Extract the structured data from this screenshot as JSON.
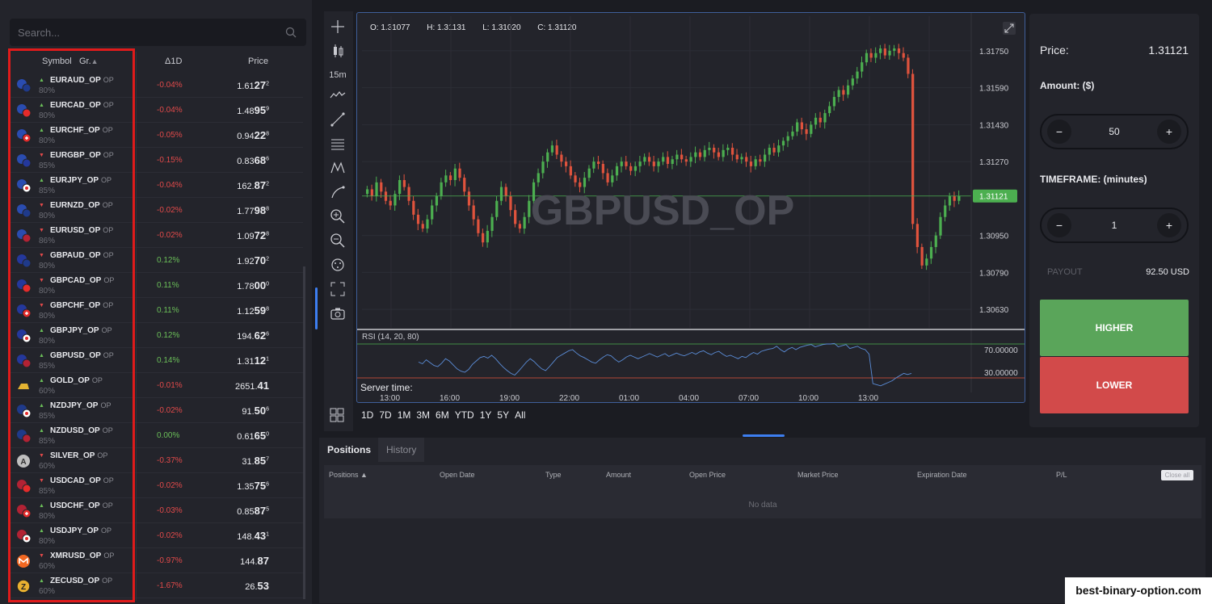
{
  "search": {
    "placeholder": "Search..."
  },
  "table_header": {
    "symbol": "Symbol",
    "group": "Gr.",
    "change": "Δ1D",
    "price": "Price"
  },
  "assets": [
    {
      "symbol": "EURAUD_OP",
      "op": "OP",
      "payout": "80%",
      "dir": "up",
      "change": "-0.04%",
      "price_main": "1.61",
      "price_big": "27",
      "price_sup": "2",
      "flag": "eu-au"
    },
    {
      "symbol": "EURCAD_OP",
      "op": "OP",
      "payout": "80%",
      "dir": "up",
      "change": "-0.04%",
      "price_main": "1.48",
      "price_big": "95",
      "price_sup": "9",
      "flag": "eu-ca"
    },
    {
      "symbol": "EURCHF_OP",
      "op": "OP",
      "payout": "80%",
      "dir": "up",
      "change": "-0.05%",
      "price_main": "0.94",
      "price_big": "22",
      "price_sup": "8",
      "flag": "eu-ch"
    },
    {
      "symbol": "EURGBP_OP",
      "op": "OP",
      "payout": "85%",
      "dir": "down",
      "change": "-0.15%",
      "price_main": "0.83",
      "price_big": "68",
      "price_sup": "6",
      "flag": "eu-gb"
    },
    {
      "symbol": "EURJPY_OP",
      "op": "OP",
      "payout": "85%",
      "dir": "up",
      "change": "-0.04%",
      "price_main": "162.",
      "price_big": "87",
      "price_sup": "2",
      "flag": "eu-jp"
    },
    {
      "symbol": "EURNZD_OP",
      "op": "OP",
      "payout": "80%",
      "dir": "down",
      "change": "-0.02%",
      "price_main": "1.77",
      "price_big": "98",
      "price_sup": "8",
      "flag": "eu-nz"
    },
    {
      "symbol": "EURUSD_OP",
      "op": "OP",
      "payout": "86%",
      "dir": "down",
      "change": "-0.02%",
      "price_main": "1.09",
      "price_big": "72",
      "price_sup": "8",
      "flag": "eu-us"
    },
    {
      "symbol": "GBPAUD_OP",
      "op": "OP",
      "payout": "80%",
      "dir": "down",
      "change": "0.12%",
      "price_main": "1.92",
      "price_big": "70",
      "price_sup": "2",
      "flag": "gb-au"
    },
    {
      "symbol": "GBPCAD_OP",
      "op": "OP",
      "payout": "80%",
      "dir": "down",
      "change": "0.11%",
      "price_main": "1.78",
      "price_big": "00",
      "price_sup": "0",
      "flag": "gb-ca"
    },
    {
      "symbol": "GBPCHF_OP",
      "op": "OP",
      "payout": "80%",
      "dir": "down",
      "change": "0.11%",
      "price_main": "1.12",
      "price_big": "59",
      "price_sup": "8",
      "flag": "gb-ch"
    },
    {
      "symbol": "GBPJPY_OP",
      "op": "OP",
      "payout": "80%",
      "dir": "up",
      "change": "0.12%",
      "price_main": "194.",
      "price_big": "62",
      "price_sup": "6",
      "flag": "gb-jp"
    },
    {
      "symbol": "GBPUSD_OP",
      "op": "OP",
      "payout": "85%",
      "dir": "up",
      "change": "0.14%",
      "price_main": "1.31",
      "price_big": "12",
      "price_sup": "1",
      "flag": "gb-us"
    },
    {
      "symbol": "GOLD_OP",
      "op": "OP",
      "payout": "60%",
      "dir": "up",
      "change": "-0.01%",
      "price_main": "2651.",
      "price_big": "41",
      "price_sup": "",
      "flag": "gold"
    },
    {
      "symbol": "NZDJPY_OP",
      "op": "OP",
      "payout": "85%",
      "dir": "up",
      "change": "-0.02%",
      "price_main": "91.",
      "price_big": "50",
      "price_sup": "6",
      "flag": "nz-jp"
    },
    {
      "symbol": "NZDUSD_OP",
      "op": "OP",
      "payout": "85%",
      "dir": "up",
      "change": "0.00%",
      "price_main": "0.61",
      "price_big": "65",
      "price_sup": "0",
      "flag": "nz-us"
    },
    {
      "symbol": "SILVER_OP",
      "op": "OP",
      "payout": "60%",
      "dir": "down",
      "change": "-0.37%",
      "price_main": "31.",
      "price_big": "85",
      "price_sup": "7",
      "flag": "silver"
    },
    {
      "symbol": "USDCAD_OP",
      "op": "OP",
      "payout": "85%",
      "dir": "down",
      "change": "-0.02%",
      "price_main": "1.35",
      "price_big": "75",
      "price_sup": "6",
      "flag": "us-ca"
    },
    {
      "symbol": "USDCHF_OP",
      "op": "OP",
      "payout": "80%",
      "dir": "up",
      "change": "-0.03%",
      "price_main": "0.85",
      "price_big": "87",
      "price_sup": "5",
      "flag": "us-ch"
    },
    {
      "symbol": "USDJPY_OP",
      "op": "OP",
      "payout": "80%",
      "dir": "up",
      "change": "-0.02%",
      "price_main": "148.",
      "price_big": "43",
      "price_sup": "1",
      "flag": "us-jp"
    },
    {
      "symbol": "XMRUSD_OP",
      "op": "OP",
      "payout": "60%",
      "dir": "down",
      "change": "-0.97%",
      "price_main": "144.",
      "price_big": "87",
      "price_sup": "",
      "flag": "xmr"
    },
    {
      "symbol": "ZECUSD_OP",
      "op": "OP",
      "payout": "60%",
      "dir": "up",
      "change": "-1.67%",
      "price_main": "26.",
      "price_big": "53",
      "price_sup": "",
      "flag": "zec"
    }
  ],
  "toolbar": {
    "interval": "15m"
  },
  "chart": {
    "ohlc": {
      "o": "O: 1.31077",
      "h": "H: 1.31131",
      "l": "L: 1.31020",
      "c": "C: 1.31120"
    },
    "symbol_watermark": "GBPUSD_OP",
    "current_price_label": "1.31121",
    "price_ticks": [
      "1.31750",
      "1.31590",
      "1.31430",
      "1.31270",
      "1.30950",
      "1.30790",
      "1.30630"
    ],
    "rsi_label": "RSI (14, 20, 80)",
    "rsi_levels": [
      "70.00000",
      "30.00000"
    ],
    "server_time_label": "Server time:",
    "time_ticks": [
      "13:00",
      "16:00",
      "19:00",
      "22:00",
      "01:00",
      "04:00",
      "07:00",
      "10:00",
      "13:00"
    ],
    "ranges": [
      "1D",
      "7D",
      "1M",
      "3M",
      "6M",
      "YTD",
      "1Y",
      "5Y",
      "All"
    ],
    "colors": {
      "up": "#4caf50",
      "down": "#e0533d",
      "accent": "#3d7ef0"
    }
  },
  "chart_data": {
    "type": "candlestick",
    "ylim": [
      1.3055,
      1.3183
    ],
    "current_price": 1.31121,
    "candle_closes": [
      1.3115,
      1.3112,
      1.3118,
      1.3114,
      1.311,
      1.3108,
      1.3113,
      1.3119,
      1.3116,
      1.311,
      1.3104,
      1.31,
      1.3098,
      1.3102,
      1.3108,
      1.3112,
      1.3118,
      1.3121,
      1.3119,
      1.3124,
      1.312,
      1.3114,
      1.3108,
      1.3102,
      1.3096,
      1.3092,
      1.3097,
      1.3103,
      1.311,
      1.3116,
      1.3112,
      1.3106,
      1.31,
      1.3098,
      1.3103,
      1.311,
      1.3118,
      1.3122,
      1.3127,
      1.3131,
      1.3134,
      1.313,
      1.3127,
      1.3125,
      1.3121,
      1.3118,
      1.3116,
      1.312,
      1.3124,
      1.3127,
      1.3126,
      1.3122,
      1.3118,
      1.3121,
      1.3125,
      1.3127,
      1.3125,
      1.3123,
      1.3125,
      1.3127,
      1.3129,
      1.3127,
      1.3125,
      1.3127,
      1.3129,
      1.3126,
      1.3128,
      1.313,
      1.3128,
      1.3127,
      1.3129,
      1.3131,
      1.3129,
      1.3132,
      1.3133,
      1.3131,
      1.3129,
      1.3132,
      1.3133,
      1.313,
      1.3128,
      1.3129,
      1.3127,
      1.3125,
      1.3128,
      1.3127,
      1.313,
      1.3133,
      1.3131,
      1.3134,
      1.3136,
      1.3138,
      1.314,
      1.3144,
      1.3141,
      1.3139,
      1.3143,
      1.3146,
      1.3144,
      1.3148,
      1.3151,
      1.3155,
      1.3158,
      1.3156,
      1.316,
      1.3163,
      1.3166,
      1.317,
      1.3174,
      1.3172,
      1.3174,
      1.3176,
      1.3173,
      1.3175,
      1.3176,
      1.3174,
      1.3172,
      1.3165,
      1.31,
      1.309,
      1.3082,
      1.3085,
      1.309,
      1.3095,
      1.3103,
      1.3108,
      1.3112,
      1.311,
      1.3112
    ],
    "rsi": [
      48,
      45,
      52,
      47,
      42,
      40,
      46,
      54,
      50,
      43,
      36,
      32,
      30,
      35,
      44,
      50,
      56,
      58,
      55,
      60,
      54,
      46,
      39,
      33,
      28,
      25,
      32,
      40,
      48,
      54,
      49,
      42,
      36,
      33,
      40,
      48,
      56,
      60,
      64,
      68,
      70,
      64,
      59,
      56,
      52,
      48,
      46,
      52,
      57,
      61,
      59,
      53,
      48,
      52,
      57,
      60,
      57,
      54,
      57,
      60,
      63,
      60,
      57,
      60,
      63,
      58,
      61,
      64,
      61,
      59,
      62,
      65,
      62,
      66,
      68,
      64,
      61,
      65,
      67,
      62,
      58,
      60,
      57,
      54,
      58,
      56,
      61,
      65,
      62,
      67,
      69,
      71,
      72,
      76,
      70,
      66,
      71,
      74,
      70,
      74,
      76,
      78,
      79,
      75,
      77,
      79,
      80,
      80,
      81,
      75,
      77,
      79,
      72,
      74,
      76,
      72,
      70,
      62,
      10,
      8,
      6,
      9,
      12,
      15,
      20,
      24,
      28,
      26,
      28
    ]
  },
  "trade": {
    "price_label": "Price:",
    "price_value": "1.31121",
    "amount_label": "Amount: ($)",
    "amount_value": "50",
    "timeframe_label": "TIMEFRAME: (minutes)",
    "timeframe_value": "1",
    "minus": "−",
    "plus": "+",
    "payout_label": "PAYOUT",
    "payout_value": "92.50 USD",
    "higher": "HIGHER",
    "lower": "LOWER",
    "colors": {
      "higher": "#5aa55a",
      "lower": "#d24a4a"
    }
  },
  "positions": {
    "tab_positions": "Positions",
    "tab_history": "History",
    "columns": [
      "Positions ▲",
      "Open Date",
      "Type",
      "Amount",
      "Open Price",
      "Market Price",
      "Expiration Date",
      "P/L"
    ],
    "close_all": "Close all",
    "empty": "No data"
  },
  "watermark": "best-binary-option.com"
}
